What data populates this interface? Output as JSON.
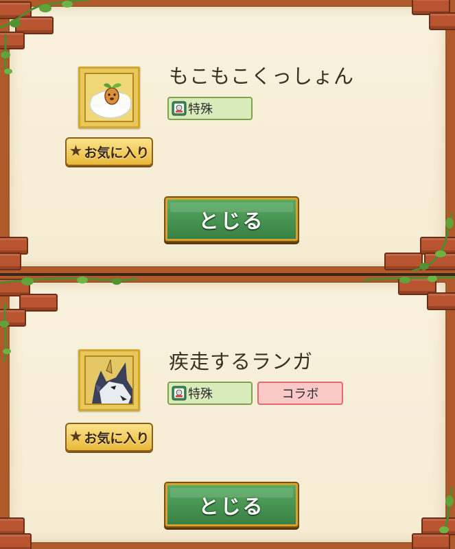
{
  "dialogs": [
    {
      "name": "もこもこくっしょん",
      "favorite_label": "お気に入り",
      "tags": [
        "特殊"
      ],
      "close_label": "とじる",
      "icon": "cotton-cushion-icon"
    },
    {
      "name": "疾走するランガ",
      "favorite_label": "お気に入り",
      "tags": [
        "特殊",
        "コラボ"
      ],
      "close_label": "とじる",
      "icon": "wolf-ranga-icon"
    }
  ],
  "colors": {
    "paper": "#f7efd8",
    "brick": "#b8542f",
    "close_button": "#4a9a55",
    "favorite_button": "#efc14a",
    "tag_special": "#d9ebbb",
    "tag_collab": "#f9c9c7"
  }
}
